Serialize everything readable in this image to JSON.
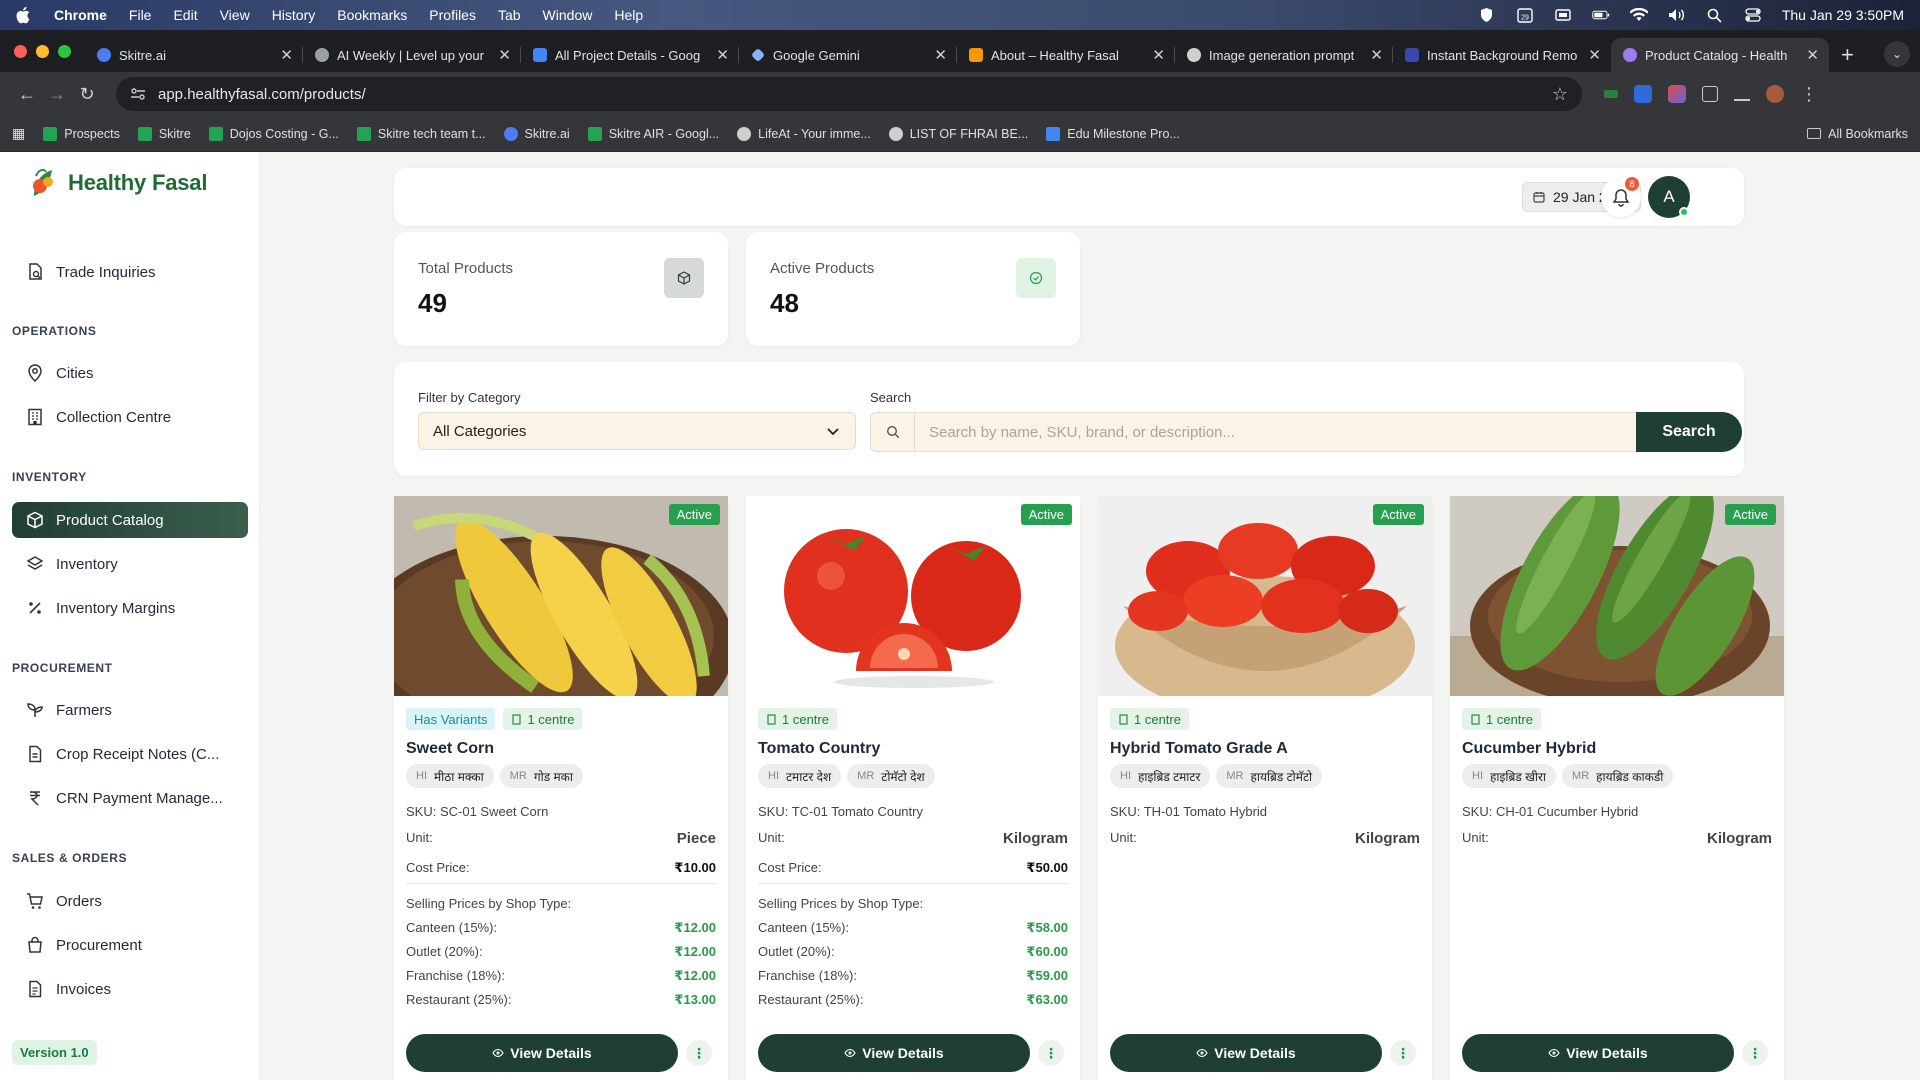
{
  "mac": {
    "app": "Chrome",
    "menu": [
      "File",
      "Edit",
      "View",
      "History",
      "Bookmarks",
      "Profiles",
      "Tab",
      "Window",
      "Help"
    ],
    "datetime": "Thu Jan 29  3:50PM",
    "cal_day": "29"
  },
  "browser": {
    "tabs": [
      {
        "title": "Skitre.ai",
        "color": "#4e7bf6"
      },
      {
        "title": "AI Weekly | Level up your",
        "color": "#9aa0a6"
      },
      {
        "title": "All Project Details - Goog",
        "color": "#4285f4"
      },
      {
        "title": "Google Gemini",
        "color": "#8ab4f8"
      },
      {
        "title": "About – Healthy Fasal",
        "color": "#f29900"
      },
      {
        "title": "Image generation prompt",
        "color": "#cfcfcf"
      },
      {
        "title": "Instant Background Remo",
        "color": "#3949ab"
      },
      {
        "title": "Product Catalog - Health",
        "color": "#9c7cf0"
      }
    ],
    "url": "app.healthyfasal.com/products/",
    "bookmarks": [
      {
        "label": "Prospects",
        "color": "#23a455"
      },
      {
        "label": "Skitre",
        "color": "#23a455"
      },
      {
        "label": "Dojos Costing - G...",
        "color": "#23a455"
      },
      {
        "label": "Skitre tech team t...",
        "color": "#23a455"
      },
      {
        "label": "Skitre.ai",
        "color": "#4e7bf6"
      },
      {
        "label": "Skitre AIR - Googl...",
        "color": "#23a455"
      },
      {
        "label": "LifeAt - Your imme...",
        "color": "#cfcfcf"
      },
      {
        "label": "LIST OF FHRAI BE...",
        "color": "#cfcfcf"
      },
      {
        "label": "Edu Milestone Pro...",
        "color": "#4285f4"
      }
    ],
    "all_bookmarks": "All Bookmarks"
  },
  "sidebar": {
    "brand": "Healthy Fasal",
    "trade": "Trade Inquiries",
    "sections": {
      "operations": "OPERATIONS",
      "inventory": "INVENTORY",
      "procurement": "PROCUREMENT",
      "sales": "SALES & ORDERS"
    },
    "items": {
      "cities": "Cities",
      "collection": "Collection Centre",
      "catalog": "Product Catalog",
      "inventory": "Inventory",
      "margins": "Inventory Margins",
      "farmers": "Farmers",
      "crn": "Crop Receipt Notes (C...",
      "crn_pay": "CRN Payment Manage...",
      "orders": "Orders",
      "procurement": "Procurement",
      "invoices": "Invoices"
    },
    "version": "Version 1.0"
  },
  "header": {
    "date": "29 Jan 2026",
    "notifications": "8",
    "avatar": "A"
  },
  "stats": {
    "total_label": "Total Products",
    "total_value": "49",
    "active_label": "Active Products",
    "active_value": "48"
  },
  "filters": {
    "category_label": "Filter by Category",
    "category_value": "All Categories",
    "search_label": "Search",
    "search_placeholder": "Search by name, SKU, brand, or description...",
    "search_button": "Search"
  },
  "labels": {
    "active": "Active",
    "has_variants": "Has Variants",
    "centre": "1 centre",
    "unit": "Unit:",
    "cost": "Cost Price:",
    "selling": "Selling Prices by Shop Type:",
    "canteen": "Canteen (15%):",
    "outlet": "Outlet (20%):",
    "franchise": "Franchise (18%):",
    "restaurant": "Restaurant (25%):",
    "view": "View Details",
    "hi": "HI",
    "mr": "MR"
  },
  "products": [
    {
      "name": "Sweet Corn",
      "hi": "मीठा मक्का",
      "mr": "गोड मका",
      "sku": "SKU: SC-01 Sweet Corn",
      "unit": "Piece",
      "cost": "₹10.00",
      "canteen": "₹12.00",
      "outlet": "₹12.00",
      "franchise": "₹12.00",
      "restaurant": "₹13.00"
    },
    {
      "name": "Tomato Country",
      "hi": "टमाटर देश",
      "mr": "टोमॅटो देश",
      "sku": "SKU: TC-01 Tomato Country",
      "unit": "Kilogram",
      "cost": "₹50.00",
      "canteen": "₹58.00",
      "outlet": "₹60.00",
      "franchise": "₹59.00",
      "restaurant": "₹63.00"
    },
    {
      "name": "Hybrid Tomato Grade A",
      "hi": "हाइब्रिड टमाटर",
      "mr": "हायब्रिड टोमॅटो",
      "sku": "SKU: TH-01 Tomato Hybrid",
      "unit": "Kilogram"
    },
    {
      "name": "Cucumber Hybrid",
      "hi": "हाइब्रिड खीरा",
      "mr": "हायब्रिड काकडी",
      "sku": "SKU: CH-01 Cucumber Hybrid",
      "unit": "Kilogram"
    }
  ]
}
